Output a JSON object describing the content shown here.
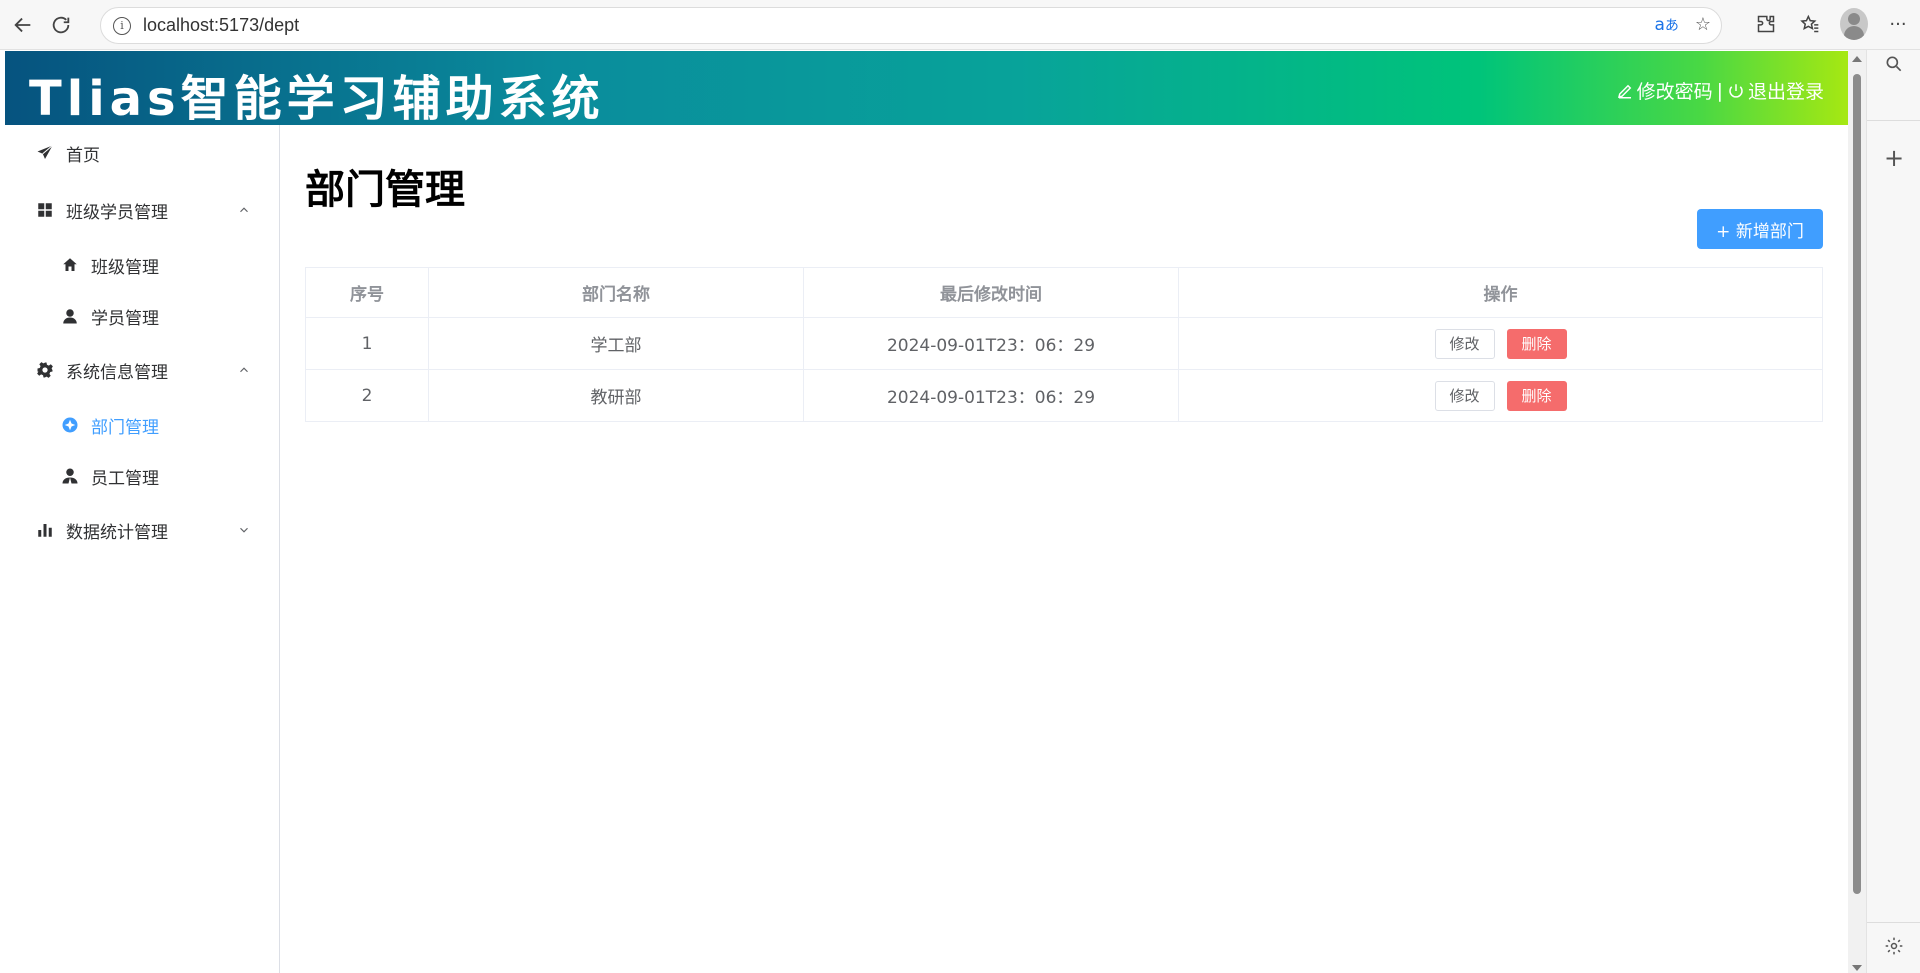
{
  "browser": {
    "url": "localhost:5173/dept",
    "translate_glyph": "あ"
  },
  "app": {
    "title": "Tlias智能学习辅助系统",
    "header": {
      "change_password": "修改密码",
      "separator": "|",
      "logout": "退出登录"
    },
    "menu": {
      "home": "首页",
      "class_student_mgmt": "班级学员管理",
      "class_mgmt": "班级管理",
      "student_mgmt": "学员管理",
      "system_info_mgmt": "系统信息管理",
      "dept_mgmt": "部门管理",
      "emp_mgmt": "员工管理",
      "data_stats_mgmt": "数据统计管理"
    },
    "main": {
      "page_title": "部门管理",
      "add_button": "+ 新增部门",
      "table": {
        "headers": [
          "序号",
          "部门名称",
          "最后修改时间",
          "操作"
        ],
        "rows": [
          {
            "index": "1",
            "name": "学工部",
            "updated": "2024-09-01T23：06：29",
            "edit": "修改",
            "delete": "删除"
          },
          {
            "index": "2",
            "name": "教研部",
            "updated": "2024-09-01T23：06：29",
            "edit": "修改",
            "delete": "删除"
          }
        ]
      }
    }
  },
  "colors": {
    "accent": "#409eff",
    "danger": "#f56c6c",
    "header_gradient_start": "#06537f",
    "header_gradient_end": "#a6e812"
  }
}
